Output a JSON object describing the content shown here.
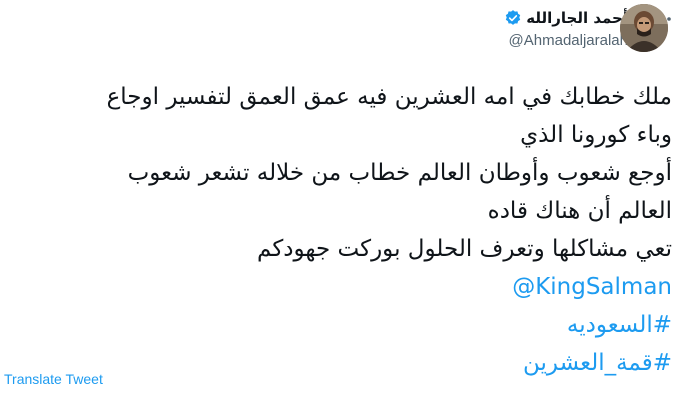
{
  "author": {
    "display_name": "أحمد الجارالله",
    "handle": "@Ahmadaljaralah",
    "verified_icon": "verified-badge-icon",
    "avatar_icon": "profile-photo"
  },
  "menu_icon": "more-options-icon",
  "tweet": {
    "lines": [
      "ملك خطابك في امه العشرين فيه عمق العمق لتفسير اوجاع",
      "وباء كورونا الذي",
      "أوجع شعوب وأوطان العالم خطاب من خلاله تشعر شعوب",
      "العالم أن هناك قاده",
      "تعي مشاكلها وتعرف الحلول بوركت جهودكم"
    ],
    "mention": "@KingSalman",
    "hashtags": [
      "#السعوديه",
      "#قمة_العشرين"
    ]
  },
  "translate_label": "Translate Tweet",
  "colors": {
    "link": "#1d9bf0",
    "text": "#0f1419",
    "secondary": "#536471"
  }
}
